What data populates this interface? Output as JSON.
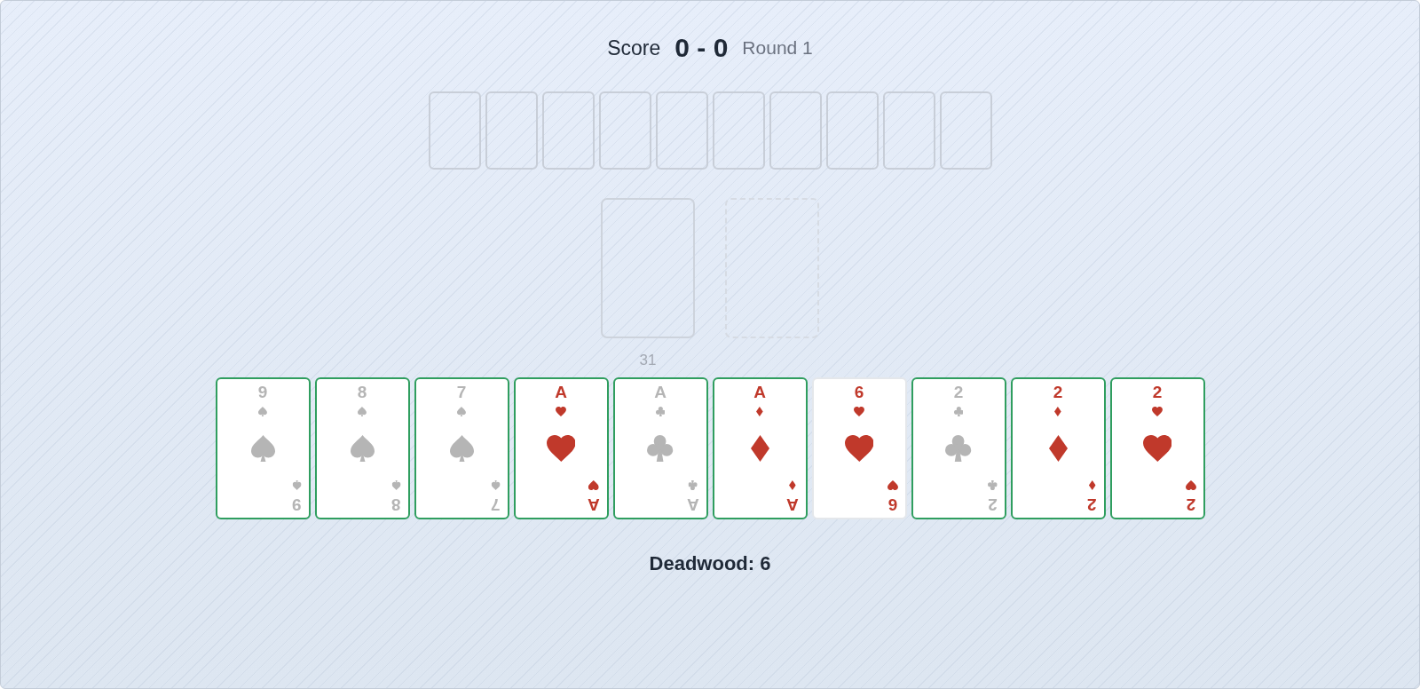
{
  "header": {
    "score_label": "Score",
    "score": "0 - 0",
    "round": "Round 1"
  },
  "opponent_hand": [
    {
      "kind": "back"
    },
    {
      "kind": "back"
    },
    {
      "kind": "back"
    },
    {
      "kind": "back"
    },
    {
      "kind": "back"
    },
    {
      "kind": "back"
    },
    {
      "kind": "back"
    },
    {
      "kind": "back"
    },
    {
      "kind": "back"
    },
    {
      "kind": "back"
    }
  ],
  "stock": {
    "count": "31"
  },
  "discard": {
    "kind": "empty"
  },
  "hand": [
    {
      "kind": "spades",
      "top_rank": "9",
      "bottom_rank": "9",
      "melded": true
    },
    {
      "kind": "spades",
      "top_rank": "8",
      "bottom_rank": "8",
      "melded": true
    },
    {
      "kind": "spades",
      "top_rank": "7",
      "bottom_rank": "7",
      "melded": true
    },
    {
      "kind": "hearts",
      "top_rank": "A",
      "bottom_rank": "A",
      "melded": true
    },
    {
      "kind": "clubs",
      "top_rank": "A",
      "bottom_rank": "A",
      "melded": true
    },
    {
      "kind": "diamonds",
      "top_rank": "A",
      "bottom_rank": "A",
      "melded": true
    },
    {
      "kind": "hearts",
      "top_rank": "6",
      "bottom_rank": "6",
      "melded": false
    },
    {
      "kind": "clubs",
      "top_rank": "2",
      "bottom_rank": "2",
      "melded": true
    },
    {
      "kind": "diamonds",
      "top_rank": "2",
      "bottom_rank": "2",
      "melded": true
    },
    {
      "kind": "hearts",
      "top_rank": "2",
      "bottom_rank": "2",
      "melded": true
    }
  ],
  "deadwood": "Deadwood: 6"
}
